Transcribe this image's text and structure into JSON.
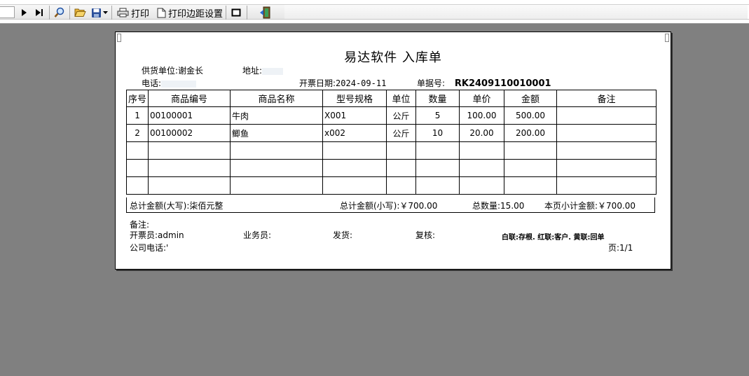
{
  "toolbar": {
    "print_label": "打印",
    "margin_label": "打印边距设置"
  },
  "report": {
    "title": "易达软件 入库单",
    "supplier_label": "供货单位:",
    "supplier_value": "谢金长",
    "address_label": "地址:",
    "phone_label": "电话:",
    "date_label": "开票日期:",
    "date_value": "2024-09-11",
    "doc_no_label": "单据号:",
    "doc_no_value": "RK2409110010001",
    "columns": [
      "序号",
      "商品编号",
      "商品名称",
      "型号规格",
      "单位",
      "数量",
      "单价",
      "金额",
      "备注"
    ],
    "rows": [
      [
        "1",
        "00100001",
        "牛肉",
        "X001",
        "公斤",
        "5",
        "100.00",
        "500.00",
        ""
      ],
      [
        "2",
        "00100002",
        "鲫鱼",
        "x002",
        "公斤",
        "10",
        "20.00",
        "200.00",
        ""
      ],
      [
        "",
        "",
        "",
        "",
        "",
        "",
        "",
        "",
        ""
      ],
      [
        "",
        "",
        "",
        "",
        "",
        "",
        "",
        "",
        ""
      ],
      [
        "",
        "",
        "",
        "",
        "",
        "",
        "",
        "",
        ""
      ]
    ],
    "total_upper": "总计金额(大写):柒佰元整",
    "total_lower": "总计金额(小写):￥700.00",
    "total_qty": "总数量:15.00",
    "page_subtotal": "本页小计金额:￥700.00",
    "remark_label": "备注:",
    "issuer": "开票员:admin",
    "salesman": "业务员:",
    "shipper": "发货:",
    "reviewer": "复核:",
    "copy_note": "白联:存根. 红联:客户. 黄联:回单",
    "company_phone": "公司电话:'",
    "page": "页:1/1"
  },
  "colors": {
    "background": "#808080",
    "paper": "#ffffff"
  }
}
